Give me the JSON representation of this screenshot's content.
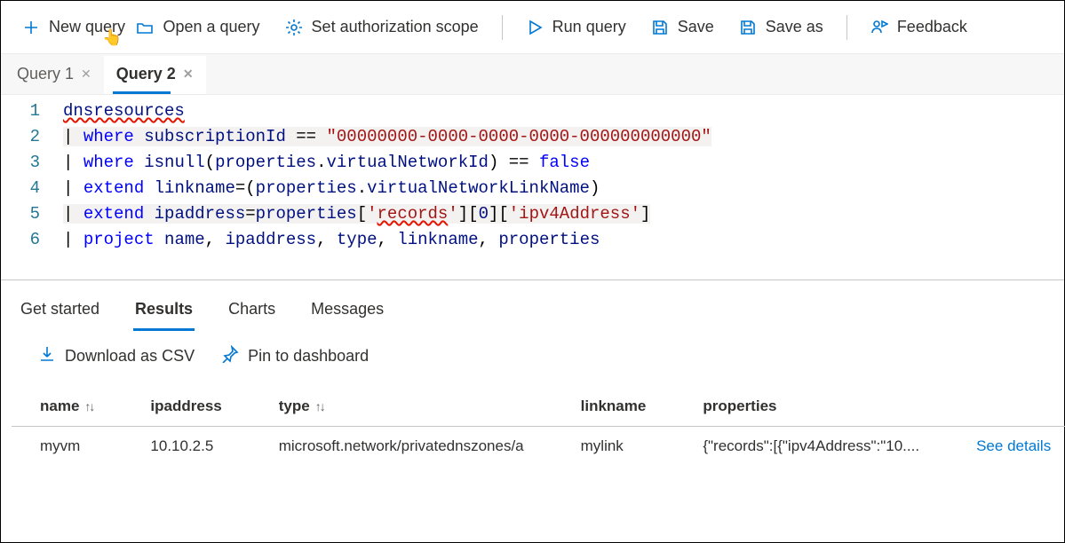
{
  "toolbar": {
    "new_query": "New query",
    "open_query": "Open a query",
    "auth_scope": "Set authorization scope",
    "run_query": "Run query",
    "save": "Save",
    "save_as": "Save as",
    "feedback": "Feedback"
  },
  "tabs": [
    {
      "label": "Query 1",
      "active": false
    },
    {
      "label": "Query 2",
      "active": true
    }
  ],
  "editor": {
    "lines": [
      {
        "n": "1",
        "html": "<span class='tok-ident squiggle'>dnsresources</span>"
      },
      {
        "n": "2",
        "html": "<span class='hl-line'><span class='tok-op'>| </span><span class='tok-kw'>where</span> <span class='tok-ident'>subscriptionId</span> <span class='tok-op'>==</span> <span class='tok-str'>\"00000000-0000-0000-0000-000000000000\"</span></span>"
      },
      {
        "n": "3",
        "html": "<span class='tok-op'>| </span><span class='tok-kw'>where</span> <span class='tok-func'>isnull</span><span class='tok-text'>(</span><span class='tok-ident'>properties</span><span class='tok-text'>.</span><span class='tok-ident'>virtualNetworkId</span><span class='tok-text'>)</span> <span class='tok-op'>==</span> <span class='tok-kw'>false</span>"
      },
      {
        "n": "4",
        "html": "<span class='tok-op'>| </span><span class='tok-kw'>extend</span> <span class='tok-ident'>linkname</span><span class='tok-op'>=</span><span class='tok-text'>(</span><span class='tok-ident'>properties</span><span class='tok-text'>.</span><span class='tok-ident'>virtualNetworkLinkName</span><span class='tok-text'>)</span>"
      },
      {
        "n": "5",
        "html": "<span class='hl-line'><span class='tok-op'>| </span><span class='tok-kw'>extend</span> <span class='tok-ident'>ipaddress</span><span class='tok-op'>=</span><span class='tok-ident'>properties</span><span class='tok-text'>[</span><span class='tok-str'>'<span class='squiggle'>records</span>'</span><span class='tok-text'>][</span><span class='tok-ident'>0</span><span class='tok-text'>][</span><span class='tok-str'>'ipv4Address'</span><span class='tok-text'>]</span></span>"
      },
      {
        "n": "6",
        "html": "<span class='tok-op'>| </span><span class='tok-kw'>project</span> <span class='tok-ident'>name</span><span class='tok-text'>, </span><span class='tok-ident'>ipaddress</span><span class='tok-text'>, </span><span class='tok-ident'>type</span><span class='tok-text'>, </span><span class='tok-ident'>linkname</span><span class='tok-text'>, </span><span class='tok-ident'>properties</span>"
      }
    ]
  },
  "result_tabs": {
    "get_started": "Get started",
    "results": "Results",
    "charts": "Charts",
    "messages": "Messages"
  },
  "result_actions": {
    "download_csv": "Download as CSV",
    "pin_dashboard": "Pin to dashboard"
  },
  "table": {
    "headers": {
      "name": "name",
      "ipaddress": "ipaddress",
      "type": "type",
      "linkname": "linkname",
      "properties": "properties"
    },
    "rows": [
      {
        "name": "myvm",
        "ipaddress": "10.10.2.5",
        "type": "microsoft.network/privatednszones/a",
        "linkname": "mylink",
        "properties": "{\"records\":[{\"ipv4Address\":\"10....",
        "details_link": "See details"
      }
    ]
  }
}
